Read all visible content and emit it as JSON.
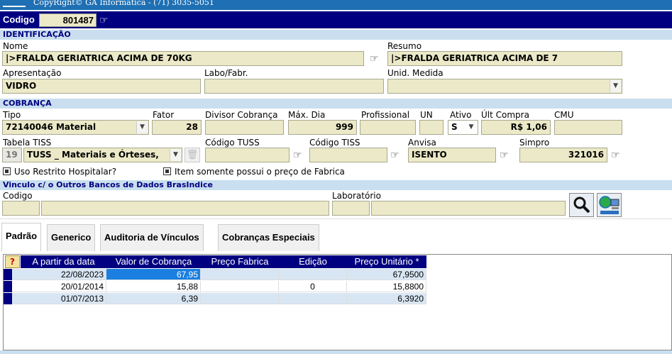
{
  "titlebar": {
    "text": "CopyRight© GA Informática - (71) 3035-5051"
  },
  "codigo": {
    "label": "Codigo",
    "value": "801487"
  },
  "identificacao": {
    "section": "IDENTIFICAÇÃO",
    "nome_label": "Nome",
    "nome_value": "|>FRALDA GERIATRICA ACIMA DE 70KG",
    "resumo_label": "Resumo",
    "resumo_value": "|>FRALDA GERIATRICA ACIMA DE 7",
    "apresentacao_label": "Apresentação",
    "apresentacao_value": "VIDRO",
    "labo_label": "Labo/Fabr.",
    "labo_value": "",
    "unid_label": "Unid. Medida",
    "unid_value": ""
  },
  "cobranca": {
    "section": "COBRANÇA",
    "tipo_label": "Tipo",
    "tipo_value": "72140046 Material",
    "fator_label": "Fator",
    "fator_value": "28",
    "divisor_label": "Divisor Cobrança",
    "divisor_value": "",
    "maxdia_label": "Máx. Dia",
    "maxdia_value": "999",
    "profissional_label": "Profissional",
    "profissional_value": "",
    "un_label": "UN",
    "un_value": "",
    "ativo_label": "Ativo",
    "ativo_value": "S",
    "ultcompra_label": "Últ Compra",
    "ultcompra_value": "R$ 1,06",
    "cmu_label": "CMU",
    "cmu_value": "",
    "tabela_label": "Tabela TISS",
    "tabela_code": "19",
    "tabela_value": "TUSS _ Materiais e Órteses,",
    "codtuss_label": "Código TUSS",
    "codtuss_value": "",
    "codtiss_label": "Código TISS",
    "codtiss_value": "",
    "anvisa_label": "Anvisa",
    "anvisa_value": "ISENTO",
    "simpro_label": "Simpro",
    "simpro_value": "321016",
    "uso_restrito": "Uso Restrito Hospitalar?",
    "preco_fabrica_only": "Item somente possui o preço de Fabrica"
  },
  "vinculo": {
    "section": "Vinculo c/ o Outros Bancos de Dados BrasIndice",
    "codigo_label": "Codigo",
    "laboratorio_label": "Laboratório"
  },
  "tabs": [
    "Padrão",
    "Generico",
    "Auditoria de Vínculos",
    "Cobranças Especiais"
  ],
  "grid": {
    "help": "?",
    "headers": [
      "A partir da data",
      "Valor de Cobrança",
      "Preço Fabrica",
      "Edição",
      "Preço Unitário *"
    ],
    "rows": [
      [
        "22/08/2023",
        "67,95",
        "",
        "",
        "67,9500"
      ],
      [
        "20/01/2014",
        "15,88",
        "",
        "0",
        "15,8800"
      ],
      [
        "01/07/2013",
        "6,39",
        "",
        "",
        "6,3920"
      ]
    ]
  },
  "colors": {
    "navy": "#000080",
    "section_bg": "#c9dfef",
    "field_bg": "#ece9c8",
    "title_blue": "#1e6fb3",
    "selected_cell": "#1a7fe0"
  },
  "icons": [
    "pointing-hand-icon",
    "dropdown-arrow-icon",
    "trash-icon",
    "search-magnifier-icon",
    "network-computer-icon"
  ]
}
